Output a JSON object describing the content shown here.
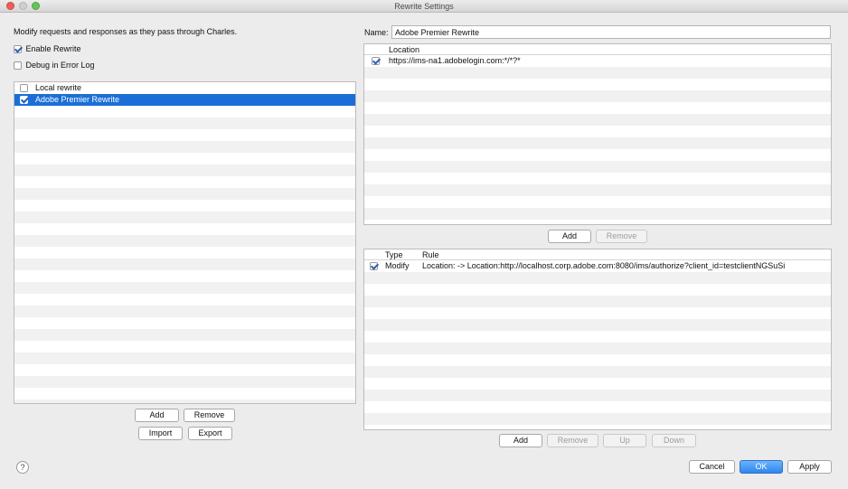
{
  "window": {
    "title": "Rewrite Settings"
  },
  "left": {
    "description": "Modify requests and responses as they pass through Charles.",
    "enable_rewrite": {
      "label": "Enable Rewrite",
      "checked": true
    },
    "debug_log": {
      "label": "Debug in Error Log",
      "checked": false
    },
    "sets": [
      {
        "label": "Local rewrite",
        "checked": false,
        "selected": false
      },
      {
        "label": "Adobe Premier Rewrite",
        "checked": true,
        "selected": true
      }
    ],
    "buttons": {
      "add": "Add",
      "remove": "Remove",
      "import": "Import",
      "export": "Export"
    }
  },
  "right": {
    "name_label": "Name:",
    "name_value": "Adobe Premier Rewrite",
    "locations": {
      "header": "Location",
      "rows": [
        {
          "checked": true,
          "location": "https://ims-na1.adobelogin.com:*/*?*"
        }
      ],
      "buttons": {
        "add": "Add",
        "remove": "Remove"
      }
    },
    "rules": {
      "headers": {
        "type": "Type",
        "rule": "Rule"
      },
      "rows": [
        {
          "checked": true,
          "type": "Modify",
          "rule": "Location: -> Location:http://localhost.corp.adobe.com:8080/ims/authorize?client_id=testclientNGSuSi"
        }
      ],
      "buttons": {
        "add": "Add",
        "remove": "Remove",
        "up": "Up",
        "down": "Down"
      }
    }
  },
  "footer": {
    "help": "?",
    "cancel": "Cancel",
    "ok": "OK",
    "apply": "Apply"
  }
}
